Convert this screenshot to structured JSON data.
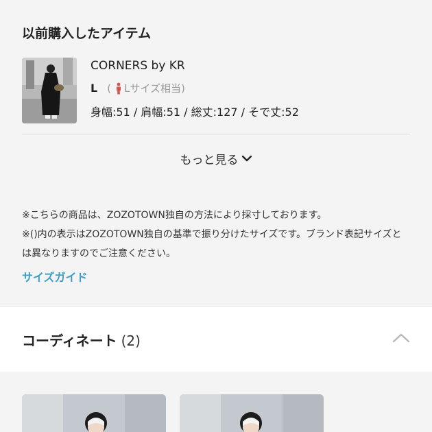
{
  "purchased": {
    "title": "以前購入したアイテム",
    "item": {
      "thumbnail_icon": "outfit-photo",
      "brand": "CORNERS by KR",
      "size": "L",
      "paren_open": "(",
      "size_equiv": "Lサイズ相当",
      "paren_close": ")",
      "measurements": "身幅:51 / 肩幅:51 / 総丈:127 / そで丈:52"
    },
    "more_label": "もっと見る",
    "notes": [
      "※こちらの商品は、ZOZOTOWN独自の方法により採寸しております。",
      "※()内の表示はZOZOTOWN独自の基準で振り分けたサイズです。ブランド表記サイズとは異なりますのでご注意ください。"
    ],
    "size_guide_label": "サイズガイド"
  },
  "coordinate": {
    "title": "コーディネート",
    "count": "(2)",
    "cards": [
      {
        "icon": "coordinate-photo"
      },
      {
        "icon": "coordinate-photo"
      }
    ]
  },
  "colors": {
    "accent": "#3aa0c8",
    "size_equiv_icon": "#d9534f",
    "background": "#f4f4f4"
  }
}
